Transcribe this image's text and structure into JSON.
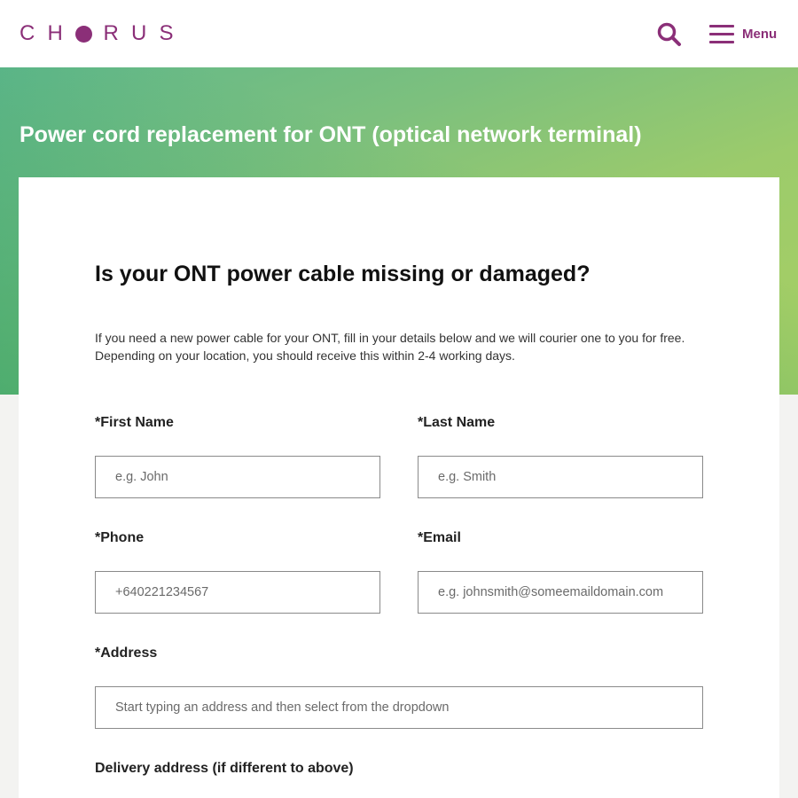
{
  "brand": {
    "letters": [
      "C",
      "H",
      "R",
      "U",
      "S"
    ],
    "color": "#8b2f78"
  },
  "header": {
    "search_icon": "search-icon",
    "menu_icon": "hamburger-menu-icon",
    "menu_label": "Menu"
  },
  "hero": {
    "title": "Power cord replacement for ONT (optical network terminal)",
    "gradient_colors": [
      "#62b88a",
      "#a8cf63",
      "#1fa373"
    ]
  },
  "form": {
    "heading": "Is your ONT power cable missing or damaged?",
    "description": "If you need a new power cable for your ONT, fill in your details below and we will courier one to you for free. Depending on your location, you should receive this within 2-4 working days.",
    "first_name": {
      "label": "*First Name",
      "placeholder": "e.g. John"
    },
    "last_name": {
      "label": "*Last Name",
      "placeholder": "e.g. Smith"
    },
    "phone": {
      "label": "*Phone",
      "placeholder": "+640221234567"
    },
    "email": {
      "label": "*Email",
      "placeholder": "e.g. johnsmith@someemaildomain.com"
    },
    "address": {
      "label": "*Address",
      "placeholder": "Start typing an address and then select from the dropdown"
    },
    "delivery_address": {
      "label": "Delivery address (if different to above)"
    }
  }
}
